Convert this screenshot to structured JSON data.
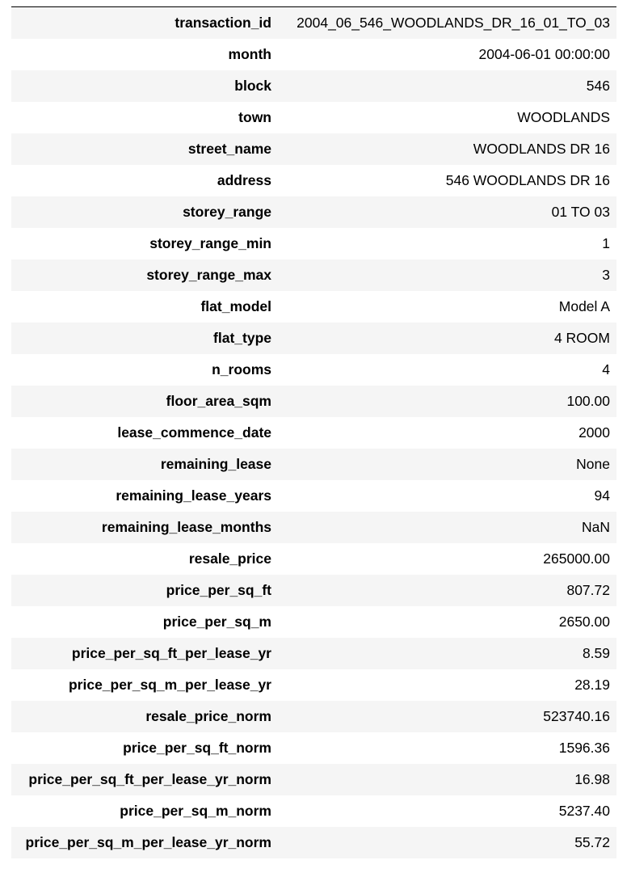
{
  "table": {
    "rows": [
      {
        "key": "transaction_id",
        "value": "2004_06_546_WOODLANDS_DR_16_01_TO_03"
      },
      {
        "key": "month",
        "value": "2004-06-01 00:00:00"
      },
      {
        "key": "block",
        "value": "546"
      },
      {
        "key": "town",
        "value": "WOODLANDS"
      },
      {
        "key": "street_name",
        "value": "WOODLANDS DR 16"
      },
      {
        "key": "address",
        "value": "546 WOODLANDS DR 16"
      },
      {
        "key": "storey_range",
        "value": "01 TO 03"
      },
      {
        "key": "storey_range_min",
        "value": "1"
      },
      {
        "key": "storey_range_max",
        "value": "3"
      },
      {
        "key": "flat_model",
        "value": "Model A"
      },
      {
        "key": "flat_type",
        "value": "4 ROOM"
      },
      {
        "key": "n_rooms",
        "value": "4"
      },
      {
        "key": "floor_area_sqm",
        "value": "100.00"
      },
      {
        "key": "lease_commence_date",
        "value": "2000"
      },
      {
        "key": "remaining_lease",
        "value": "None"
      },
      {
        "key": "remaining_lease_years",
        "value": "94"
      },
      {
        "key": "remaining_lease_months",
        "value": "NaN"
      },
      {
        "key": "resale_price",
        "value": "265000.00"
      },
      {
        "key": "price_per_sq_ft",
        "value": "807.72"
      },
      {
        "key": "price_per_sq_m",
        "value": "2650.00"
      },
      {
        "key": "price_per_sq_ft_per_lease_yr",
        "value": "8.59"
      },
      {
        "key": "price_per_sq_m_per_lease_yr",
        "value": "28.19"
      },
      {
        "key": "resale_price_norm",
        "value": "523740.16"
      },
      {
        "key": "price_per_sq_ft_norm",
        "value": "1596.36"
      },
      {
        "key": "price_per_sq_ft_per_lease_yr_norm",
        "value": "16.98"
      },
      {
        "key": "price_per_sq_m_norm",
        "value": "5237.40"
      },
      {
        "key": "price_per_sq_m_per_lease_yr_norm",
        "value": "55.72"
      }
    ]
  },
  "colors": {
    "stripe": "#f5f5f5",
    "background": "#ffffff",
    "text": "#000000",
    "rule": "#000000"
  }
}
